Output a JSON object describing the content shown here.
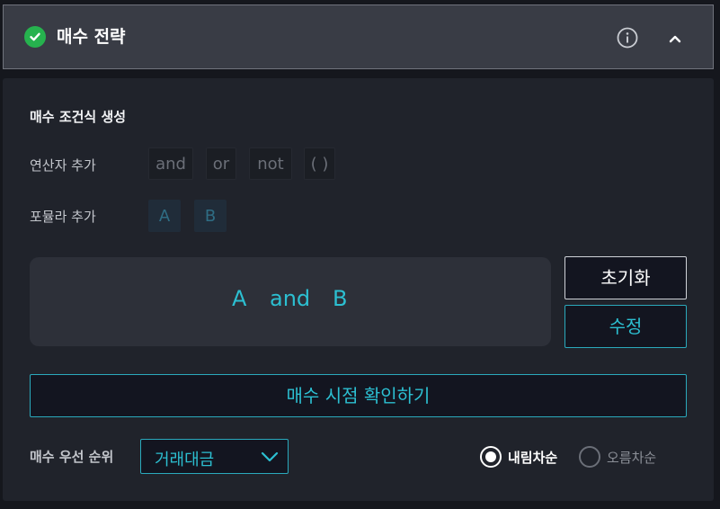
{
  "header": {
    "title": "매수 전략",
    "status_icon": "check-circle-icon",
    "status_color": "#26b24e",
    "info_icon": "info-icon",
    "collapse_icon": "chevron-up-icon"
  },
  "builder": {
    "section_title": "매수 조건식 생성",
    "operators_label": "연산자 추가",
    "operators": [
      "and",
      "or",
      "not",
      "( )"
    ],
    "formulas_label": "포뮬라 추가",
    "formulas": [
      "A",
      "B"
    ],
    "expression": [
      "A",
      "and",
      "B"
    ],
    "reset_label": "초기화",
    "edit_label": "수정",
    "confirm_label": "매수 시점 확인하기"
  },
  "priority": {
    "label": "매수 우선 순위",
    "selected": "거래대금",
    "sort_options": [
      {
        "label": "내림차순",
        "selected": true
      },
      {
        "label": "오름차순",
        "selected": false
      }
    ]
  },
  "colors": {
    "accent": "#2cbfd1",
    "panel_bg": "#20232b",
    "header_bg": "#393c45"
  }
}
